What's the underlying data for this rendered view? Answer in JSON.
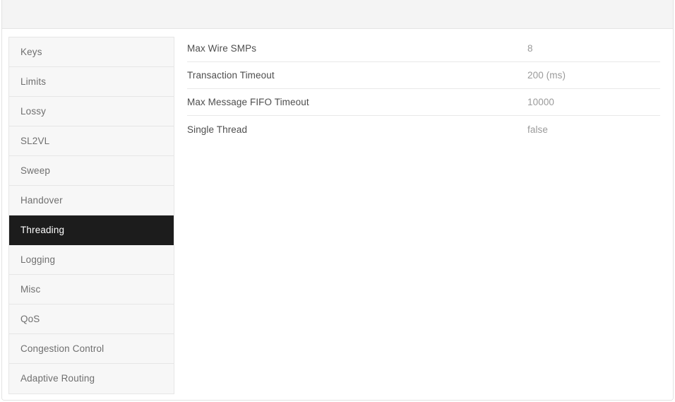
{
  "header": {
    "title": ""
  },
  "sidebar": {
    "name": "settings-categories",
    "active_index": 6,
    "items": [
      {
        "label": "Keys",
        "active": false
      },
      {
        "label": "Limits",
        "active": false
      },
      {
        "label": "Lossy",
        "active": false
      },
      {
        "label": "SL2VL",
        "active": false
      },
      {
        "label": "Sweep",
        "active": false
      },
      {
        "label": "Handover",
        "active": false
      },
      {
        "label": "Threading",
        "active": true
      },
      {
        "label": "Logging",
        "active": false
      },
      {
        "label": "Misc",
        "active": false
      },
      {
        "label": "QoS",
        "active": false
      },
      {
        "label": "Congestion Control",
        "active": false
      },
      {
        "label": "Adaptive Routing",
        "active": false
      }
    ]
  },
  "settings": {
    "section": "Threading",
    "rows": [
      {
        "label": "Max Wire SMPs",
        "value": "8"
      },
      {
        "label": "Transaction Timeout",
        "value": "200 (ms)"
      },
      {
        "label": "Max Message FIFO Timeout",
        "value": "10000"
      },
      {
        "label": "Single Thread",
        "value": "false"
      }
    ]
  },
  "colors": {
    "active_nav_bg": "#1c1c1c",
    "active_nav_text": "#ffffff",
    "sidebar_bg": "#f7f7f7",
    "header_bg": "#f4f4f4",
    "label_text": "#4e4e4e",
    "value_text": "#9a9a9a",
    "nav_text": "#6f6f6f",
    "border": "#e6e6e6"
  }
}
